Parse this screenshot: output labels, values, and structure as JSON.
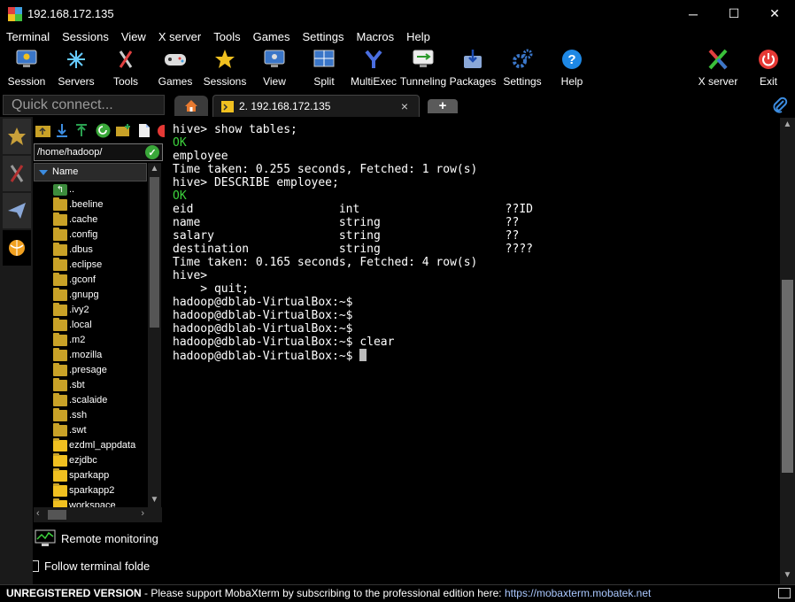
{
  "window": {
    "title": "192.168.172.135",
    "minimize": "─",
    "maximize": "☐",
    "close": "✕"
  },
  "menu": [
    "Terminal",
    "Sessions",
    "View",
    "X server",
    "Tools",
    "Games",
    "Settings",
    "Macros",
    "Help"
  ],
  "toolbar": {
    "session": "Session",
    "servers": "Servers",
    "tools": "Tools",
    "games": "Games",
    "sessions": "Sessions",
    "view": "View",
    "split": "Split",
    "multiexec": "MultiExec",
    "tunneling": "Tunneling",
    "packages": "Packages",
    "settings": "Settings",
    "help": "Help",
    "xserver": "X server",
    "exit": "Exit"
  },
  "quick_connect": {
    "placeholder": "Quick connect..."
  },
  "tabs": {
    "session_tab": "2. 192.168.172.135",
    "close": "×",
    "add": "+"
  },
  "sidebar": {
    "path": "/home/hadoop/",
    "column": "Name",
    "files": [
      "..",
      ".beeline",
      ".cache",
      ".config",
      ".dbus",
      ".eclipse",
      ".gconf",
      ".gnupg",
      ".ivy2",
      ".local",
      ".m2",
      ".mozilla",
      ".presage",
      ".sbt",
      ".scalaide",
      ".ssh",
      ".swt",
      "ezdml_appdata",
      "ezjdbc",
      "sparkapp",
      "sparkapp2",
      "workspace"
    ],
    "remote_monitoring": "Remote monitoring",
    "follow_terminal": "Follow terminal folde"
  },
  "terminal": {
    "lines": [
      {
        "text": "hive> show tables;",
        "style": "normal"
      },
      {
        "text": "OK",
        "style": "ok"
      },
      {
        "text": "employee",
        "style": "normal"
      },
      {
        "text": "Time taken: 0.255 seconds, Fetched: 1 row(s)",
        "style": "normal"
      },
      {
        "text": "hive> DESCRIBE employee;",
        "style": "normal"
      },
      {
        "text": "OK",
        "style": "ok"
      },
      {
        "text": "eid                     int                     ??ID",
        "style": "normal"
      },
      {
        "text": "name                    string                  ??",
        "style": "normal"
      },
      {
        "text": "salary                  string                  ??",
        "style": "normal"
      },
      {
        "text": "destination             string                  ????",
        "style": "normal"
      },
      {
        "text": "Time taken: 0.165 seconds, Fetched: 4 row(s)",
        "style": "normal"
      },
      {
        "text": "hive>",
        "style": "normal"
      },
      {
        "text": "    > quit;",
        "style": "normal"
      },
      {
        "text": "hadoop@dblab-VirtualBox:~$",
        "style": "normal"
      },
      {
        "text": "hadoop@dblab-VirtualBox:~$",
        "style": "normal"
      },
      {
        "text": "hadoop@dblab-VirtualBox:~$",
        "style": "normal"
      },
      {
        "text": "hadoop@dblab-VirtualBox:~$ clear",
        "style": "normal"
      },
      {
        "text": "hadoop@dblab-VirtualBox:~$ ",
        "style": "cursor"
      }
    ]
  },
  "status": {
    "unregistered": "UNREGISTERED VERSION",
    "message": "  -  Please support MobaXterm by subscribing to the professional edition here:  ",
    "link": "https://mobaxterm.mobatek.net"
  },
  "colors": {
    "ok_green": "#3dd23d",
    "accent_blue": "#3c8ce0",
    "folder": "#c9a227"
  }
}
